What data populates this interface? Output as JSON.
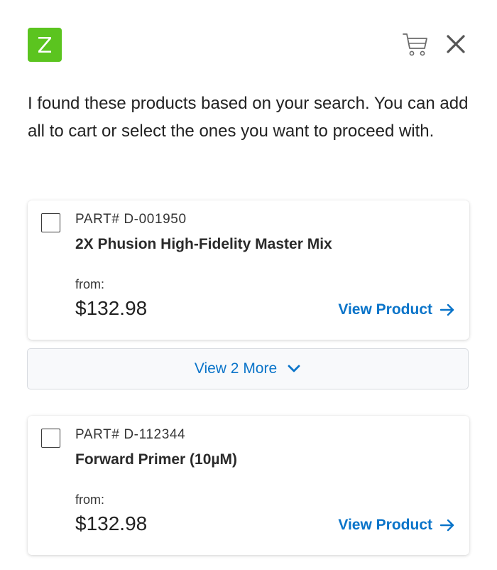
{
  "header": {
    "logo_letter": "Z",
    "logo_color": "#5bc41f",
    "cart_icon": "cart-icon",
    "close_icon": "close-icon"
  },
  "intro_text": "I found these products based on your search. You can add all to cart or select the ones you want to proceed with.",
  "products": [
    {
      "part": "PART# D-001950",
      "name": "2X Phusion High-Fidelity Master Mix",
      "from_label": "from:",
      "price": "$132.98",
      "view_label": "View Product",
      "checked": false
    },
    {
      "part": "PART# D-112344",
      "name": "Forward Primer (10µM)",
      "from_label": "from:",
      "price": "$132.98",
      "view_label": "View Product",
      "checked": false
    }
  ],
  "view_more_label": "View 2 More",
  "colors": {
    "accent": "#0a74c9",
    "brand": "#5bc41f"
  }
}
